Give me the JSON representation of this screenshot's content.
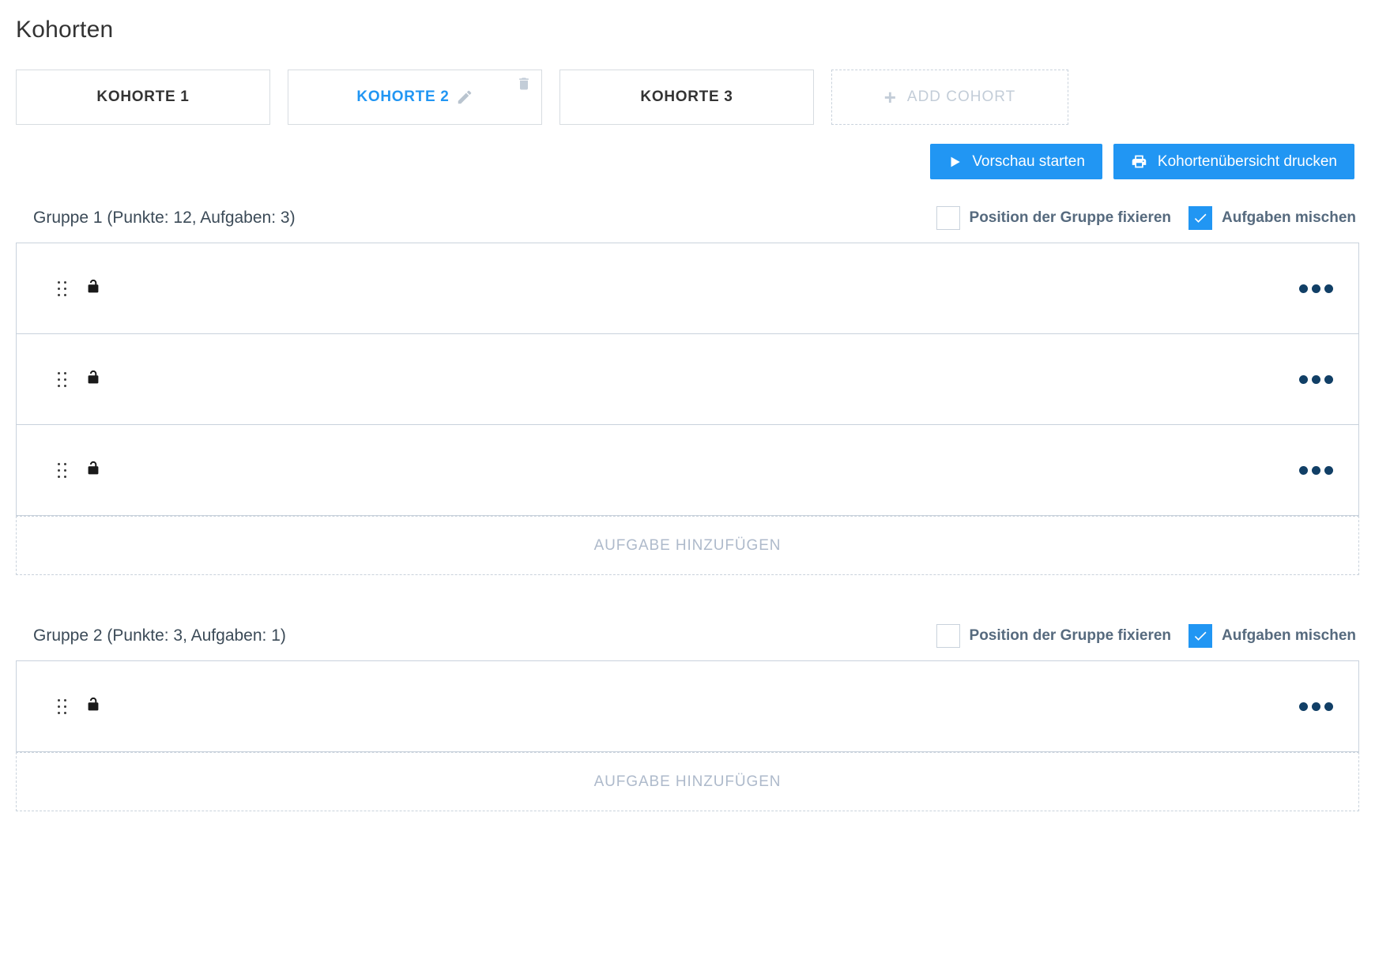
{
  "page": {
    "title": "Kohorten"
  },
  "cohorts": {
    "tabs": [
      {
        "label": "KOHORTE 1",
        "active": false,
        "editable": false,
        "deletable": false
      },
      {
        "label": "KOHORTE 2",
        "active": true,
        "editable": true,
        "deletable": true
      },
      {
        "label": "KOHORTE 3",
        "active": false,
        "editable": false,
        "deletable": false
      }
    ],
    "add_label": "ADD COHORT",
    "add_icon": "plus-icon",
    "edit_icon": "pencil-icon",
    "delete_icon": "trash-icon"
  },
  "actions": {
    "preview": {
      "label": "Vorschau starten",
      "icon": "play-icon"
    },
    "print": {
      "label": "Kohortenübersicht drucken",
      "icon": "printer-icon"
    }
  },
  "groups": [
    {
      "title": "Gruppe 1 (Punkte: 12, Aufgaben: 3)",
      "fix_position": {
        "label": "Position der Gruppe fixieren",
        "checked": false
      },
      "shuffle_tasks": {
        "label": "Aufgaben mischen",
        "checked": true
      },
      "tasks": [
        {
          "drag_icon": "drag-handle-icon",
          "lock_icon": "unlock-icon",
          "menu_icon": "kebab-menu-icon",
          "text": ""
        },
        {
          "drag_icon": "drag-handle-icon",
          "lock_icon": "unlock-icon",
          "menu_icon": "kebab-menu-icon",
          "text": ""
        },
        {
          "drag_icon": "drag-handle-icon",
          "lock_icon": "unlock-icon",
          "menu_icon": "kebab-menu-icon",
          "text": ""
        }
      ],
      "add_task_label": "AUFGABE HINZUFÜGEN"
    },
    {
      "title": "Gruppe 2 (Punkte: 3, Aufgaben: 1)",
      "fix_position": {
        "label": "Position der Gruppe fixieren",
        "checked": false
      },
      "shuffle_tasks": {
        "label": "Aufgaben mischen",
        "checked": true
      },
      "tasks": [
        {
          "drag_icon": "drag-handle-icon",
          "lock_icon": "unlock-icon",
          "menu_icon": "kebab-menu-icon",
          "text": ""
        }
      ],
      "add_task_label": "AUFGABE HINZUFÜGEN"
    }
  ],
  "colors": {
    "accent": "#2196f3",
    "border": "#c9d2dc",
    "muted_text": "#aebacb",
    "label_text": "#566a7e",
    "kebab": "#113f66"
  }
}
